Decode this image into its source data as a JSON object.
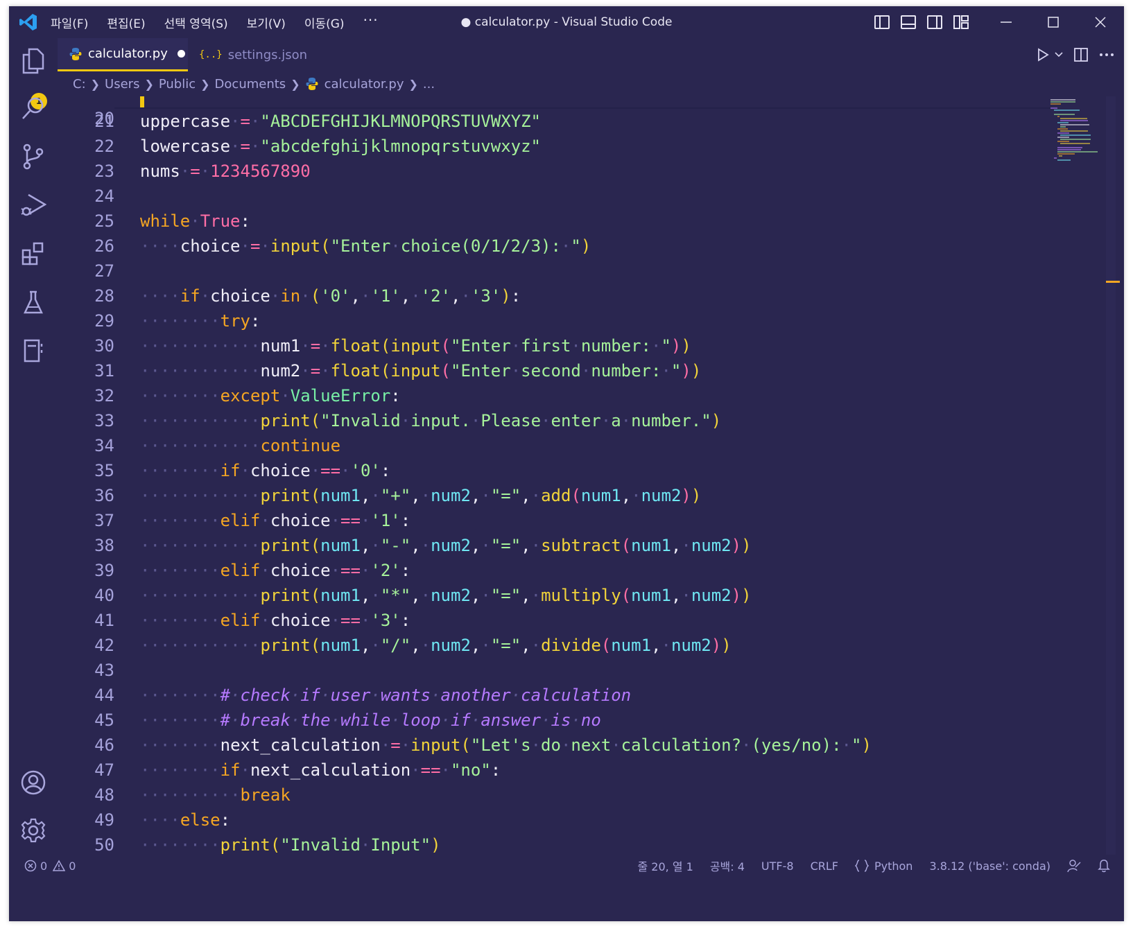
{
  "titlebar": {
    "menus": [
      "파일(F)",
      "편집(E)",
      "선택 영역(S)",
      "보기(V)",
      "이동(G)"
    ],
    "more": "···",
    "title": "● calculator.py - Visual Studio Code"
  },
  "activity": {
    "explorer_badge": "1"
  },
  "tabs": [
    {
      "label": "calculator.py",
      "modified": true
    },
    {
      "label": "settings.json",
      "glyph": "{..}"
    }
  ],
  "breadcrumb": [
    "C:",
    "Users",
    "Public",
    "Documents",
    "calculator.py",
    "..."
  ],
  "editor": {
    "partial_top_line": "20",
    "lines": [
      {
        "n": "21",
        "text": "uppercase = \"ABCDEFGHIJKLMNOPQRSTUVWXYZ\""
      },
      {
        "n": "22",
        "text": "lowercase = \"abcdefghijklmnopqrstuvwxyz\""
      },
      {
        "n": "23",
        "text": "nums = 1234567890"
      },
      {
        "n": "24",
        "text": ""
      },
      {
        "n": "25",
        "text": "while True:"
      },
      {
        "n": "26",
        "text": "    choice = input(\"Enter choice(0/1/2/3): \")"
      },
      {
        "n": "27",
        "text": ""
      },
      {
        "n": "28",
        "text": "    if choice in ('0', '1', '2', '3'):"
      },
      {
        "n": "29",
        "text": "        try:"
      },
      {
        "n": "30",
        "text": "            num1 = float(input(\"Enter first number: \"))"
      },
      {
        "n": "31",
        "text": "            num2 = float(input(\"Enter second number: \"))"
      },
      {
        "n": "32",
        "text": "        except ValueError:"
      },
      {
        "n": "33",
        "text": "            print(\"Invalid input. Please enter a number.\")"
      },
      {
        "n": "34",
        "text": "            continue"
      },
      {
        "n": "35",
        "text": "        if choice == '0':"
      },
      {
        "n": "36",
        "text": "            print(num1, \"+\", num2, \"=\", add(num1, num2))"
      },
      {
        "n": "37",
        "text": "        elif choice == '1':"
      },
      {
        "n": "38",
        "text": "            print(num1, \"-\", num2, \"=\", subtract(num1, num2))"
      },
      {
        "n": "39",
        "text": "        elif choice == '2':"
      },
      {
        "n": "40",
        "text": "            print(num1, \"*\", num2, \"=\", multiply(num1, num2))"
      },
      {
        "n": "41",
        "text": "        elif choice == '3':"
      },
      {
        "n": "42",
        "text": "            print(num1, \"/\", num2, \"=\", divide(num1, num2))"
      },
      {
        "n": "43",
        "text": ""
      },
      {
        "n": "44",
        "text": "        # check if user wants another calculation"
      },
      {
        "n": "45",
        "text": "        # break the while loop if answer is no"
      },
      {
        "n": "46",
        "text": "        next_calculation = input(\"Let's do next calculation? (yes/no): \")"
      },
      {
        "n": "47",
        "text": "        if next_calculation == \"no\":"
      },
      {
        "n": "48",
        "text": "          break"
      },
      {
        "n": "49",
        "text": "    else:"
      },
      {
        "n": "50",
        "text": "        print(\"Invalid Input\")"
      }
    ]
  },
  "statusbar": {
    "errors": "0",
    "warnings": "0",
    "position": "줄 20, 열 1",
    "spaces": "공백: 4",
    "encoding": "UTF-8",
    "eol": "CRLF",
    "language": "Python",
    "interpreter": "3.8.12 ('base': conda)"
  },
  "colors": {
    "background": "#2a2650",
    "accent": "#f2c811",
    "keyword": "#f5a623",
    "string": "#a6f29a",
    "number": "#ff6ea6",
    "comment": "#b67aff",
    "variable": "#6fe6f2"
  }
}
